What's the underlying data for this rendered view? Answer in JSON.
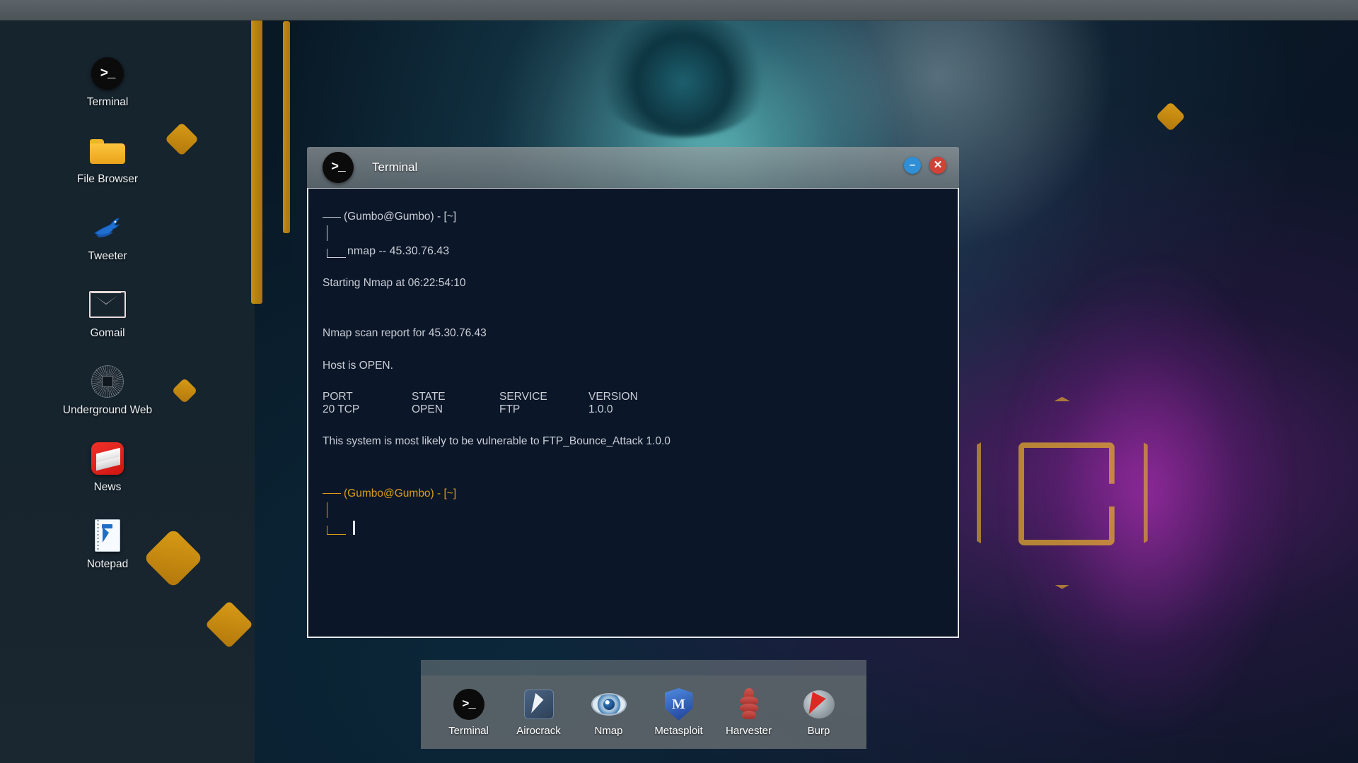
{
  "desktop": {
    "icons": [
      {
        "label": "Terminal",
        "icon": "terminal-icon"
      },
      {
        "label": "File Browser",
        "icon": "folder-icon"
      },
      {
        "label": "Tweeter",
        "icon": "bird-icon"
      },
      {
        "label": "Gomail",
        "icon": "envelope-icon"
      },
      {
        "label": "Underground Web",
        "icon": "compass-web-icon"
      },
      {
        "label": "News",
        "icon": "news-icon"
      },
      {
        "label": "Notepad",
        "icon": "notepad-icon"
      }
    ]
  },
  "window": {
    "title": "Terminal",
    "icon": "terminal-icon",
    "prompt_glyph": ">_",
    "controls": {
      "minimize": "–",
      "close": "✕"
    }
  },
  "terminal": {
    "prompt_top": {
      "host": "(Gumbo@Gumbo) - [~]",
      "command": "nmap -- 45.30.76.43"
    },
    "output": {
      "starting": "Starting Nmap at 06:22:54:10",
      "scan_report": "Nmap scan report for 45.30.76.43",
      "host_status": "Host is OPEN.",
      "vulnerability": "This system is most likely to be vulnerable to FTP_Bounce_Attack 1.0.0"
    },
    "table": {
      "headers": [
        "PORT",
        "STATE",
        "SERVICE",
        "VERSION"
      ],
      "rows": [
        [
          "20 TCP",
          "OPEN",
          "FTP",
          "1.0.0"
        ]
      ]
    },
    "prompt_bottom": {
      "host": "(Gumbo@Gumbo) - [~]",
      "command": ""
    },
    "colors": {
      "background": "#0b1628",
      "text": "#c9ced6",
      "prompt_amber": "#d99c16",
      "cursor": "#dfe3e8"
    }
  },
  "dock": {
    "items": [
      {
        "label": "Terminal",
        "icon": "terminal-icon",
        "glyph": ">_"
      },
      {
        "label": "Airocrack",
        "icon": "airocrack-lightning-icon"
      },
      {
        "label": "Nmap",
        "icon": "eye-icon"
      },
      {
        "label": "Metasploit",
        "icon": "shield-m-icon",
        "glyph": "M"
      },
      {
        "label": "Harvester",
        "icon": "wheat-icon"
      },
      {
        "label": "Burp",
        "icon": "burp-lightning-icon"
      }
    ]
  }
}
